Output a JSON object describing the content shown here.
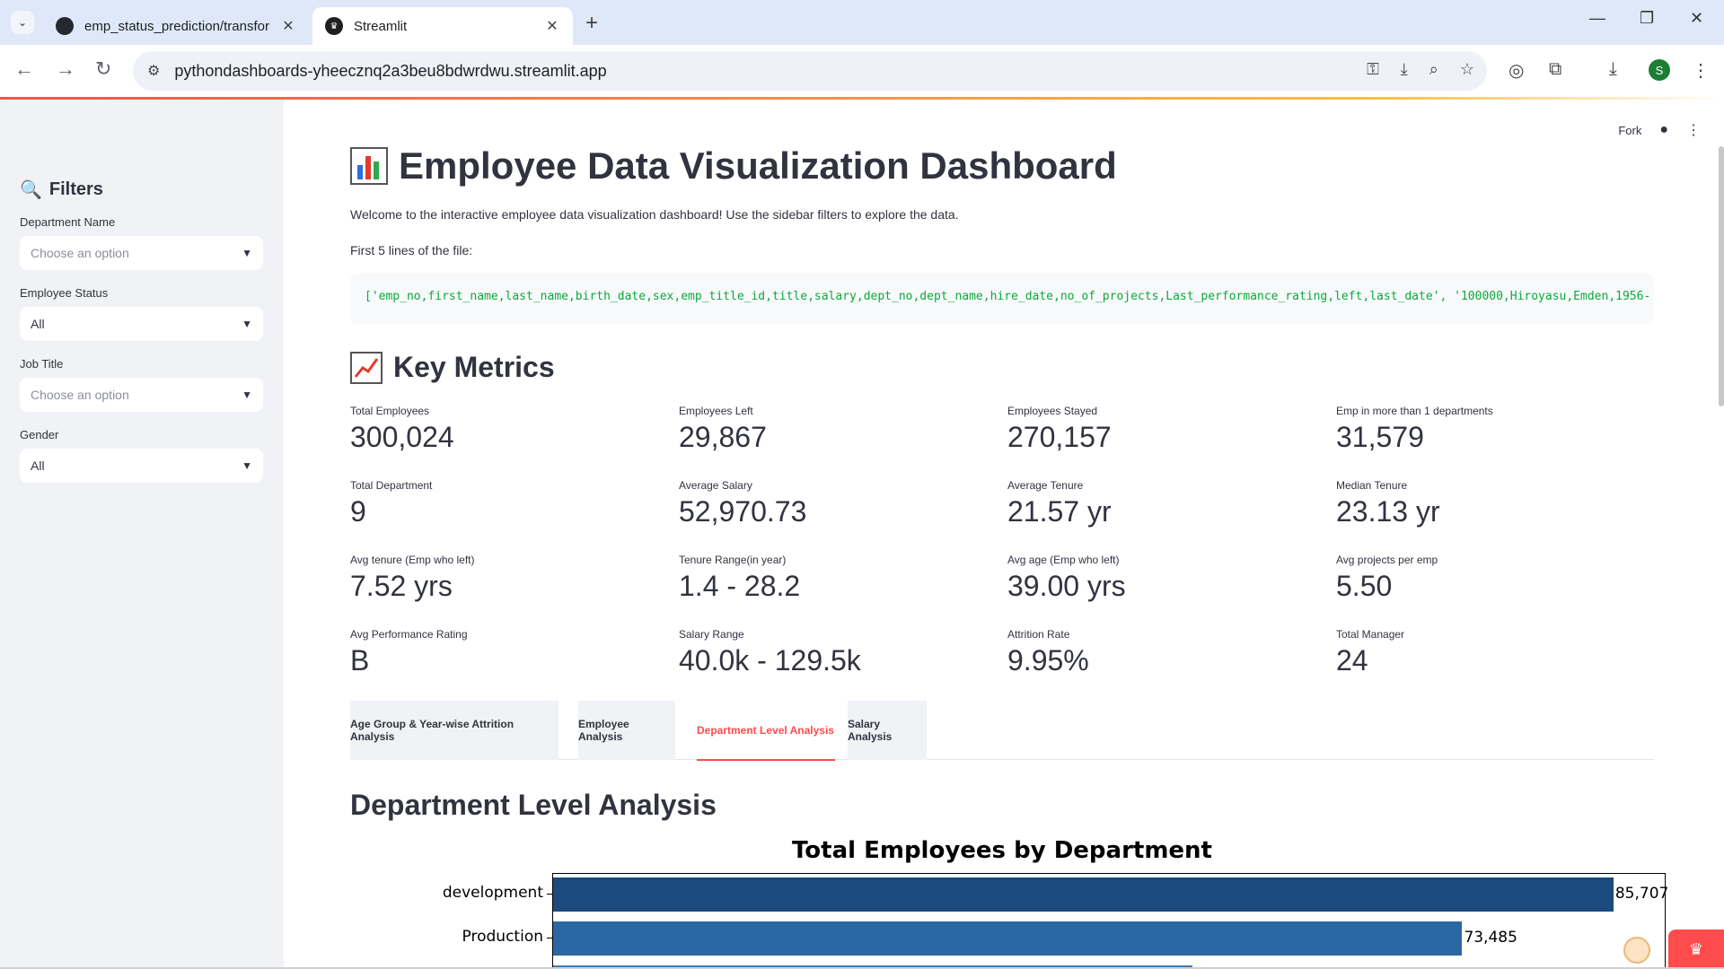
{
  "browser": {
    "tabs": [
      {
        "title": "emp_status_prediction/transfor",
        "active": false
      },
      {
        "title": "Streamlit",
        "active": true
      }
    ],
    "url": "pythondashboards-yheecznq2a3beu8bdwrdwu.streamlit.app",
    "profile_initial": "S"
  },
  "toolbar": {
    "fork_label": "Fork"
  },
  "sidebar": {
    "title": "Filters",
    "filters": [
      {
        "label": "Department Name",
        "value": "Choose an option",
        "is_placeholder": true
      },
      {
        "label": "Employee Status",
        "value": "All",
        "is_placeholder": false
      },
      {
        "label": "Job Title",
        "value": "Choose an option",
        "is_placeholder": true
      },
      {
        "label": "Gender",
        "value": "All",
        "is_placeholder": false
      }
    ]
  },
  "main": {
    "title": "Employee Data Visualization Dashboard",
    "intro": "Welcome to the interactive employee data visualization dashboard! Use the sidebar filters to explore the data.",
    "first_lines_label": "First 5 lines of the file:",
    "code_text": "['emp_no,first_name,last_name,birth_date,sex,emp_title_id,title,salary,dept_no,dept_name,hire_date,no_of_projects,Last_performance_rating,left,last_date', '100000,Hiroyasu,Emden,1956-",
    "key_metrics_title": "Key Metrics",
    "metrics": [
      {
        "label": "Total Employees",
        "value": "300,024"
      },
      {
        "label": "Employees Left",
        "value": "29,867"
      },
      {
        "label": "Employees Stayed",
        "value": "270,157"
      },
      {
        "label": "Emp in more than 1 departments",
        "value": "31,579"
      },
      {
        "label": "Total Department",
        "value": "9"
      },
      {
        "label": "Average Salary",
        "value": "52,970.73"
      },
      {
        "label": "Average Tenure",
        "value": "21.57 yr"
      },
      {
        "label": "Median Tenure",
        "value": "23.13 yr"
      },
      {
        "label": "Avg tenure (Emp who left)",
        "value": "7.52 yrs"
      },
      {
        "label": "Tenure Range(in year)",
        "value": "1.4 - 28.2"
      },
      {
        "label": "Avg age (Emp who left)",
        "value": "39.00 yrs"
      },
      {
        "label": "Avg projects per emp",
        "value": "5.50"
      },
      {
        "label": "Avg Performance Rating",
        "value": "B"
      },
      {
        "label": "Salary Range",
        "value": "40.0k - 129.5k"
      },
      {
        "label": "Attrition Rate",
        "value": "9.95%"
      },
      {
        "label": "Total Manager",
        "value": "24"
      }
    ],
    "tabs": [
      {
        "label": "Age Group & Year-wise Attrition Analysis",
        "active": false
      },
      {
        "label": "Employee Analysis",
        "active": false
      },
      {
        "label": "Department Level Analysis",
        "active": true
      },
      {
        "label": "Salary Analysis",
        "active": false
      }
    ],
    "section_title": "Department Level Analysis"
  },
  "chart_data": {
    "type": "bar",
    "orientation": "horizontal",
    "title": "Total Employees by Department",
    "categories": [
      "development",
      "Production"
    ],
    "values": [
      85707,
      73485
    ],
    "value_labels": [
      "85,707",
      "73,485"
    ],
    "colors": [
      "#1a4a7e",
      "#2b67a3"
    ],
    "xlim": [
      0,
      90000
    ],
    "note_partial": "chart cut off at bottom of screenshot"
  },
  "colors": {
    "accent": "#ff4b4b",
    "sidebar_bg": "#f0f2f6",
    "code_green": "#09ab3b"
  }
}
